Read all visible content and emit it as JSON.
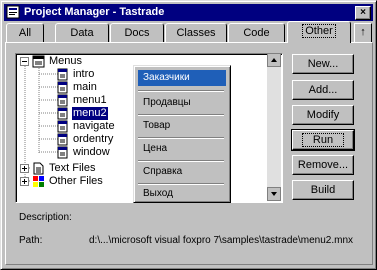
{
  "window": {
    "title": "Project Manager - Tastrade",
    "close_glyph": "×"
  },
  "tabs": [
    {
      "label": "All"
    },
    {
      "label": "Data"
    },
    {
      "label": "Docs"
    },
    {
      "label": "Classes"
    },
    {
      "label": "Code"
    },
    {
      "label": "Other"
    }
  ],
  "pin_glyph": "↑",
  "tree": {
    "root": "Menus",
    "children": [
      "intro",
      "main",
      "menu1",
      "menu2",
      "navigate",
      "ordentry",
      "window"
    ],
    "selected": "menu2",
    "groups": [
      "Text Files",
      "Other Files"
    ]
  },
  "buttons": {
    "new": "New...",
    "add": "Add...",
    "modify": "Modify",
    "run": "Run",
    "remove": "Remove...",
    "build": "Build"
  },
  "context_menu": {
    "items": [
      "Заказчики",
      "Продавцы",
      "Товар",
      "Цена",
      "Справка",
      "Выход"
    ],
    "selected_index": 0
  },
  "footer": {
    "description_label": "Description:",
    "description_value": "",
    "path_label": "Path:",
    "path_value": "d:\\...\\microsoft visual foxpro 7\\samples\\tastrade\\menu2.mnx"
  }
}
